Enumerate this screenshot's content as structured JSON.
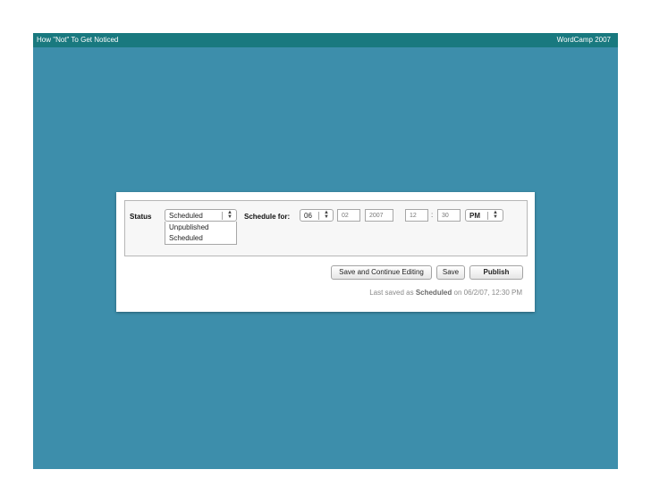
{
  "slide": {
    "title_left": "How \"Not\" To Get Noticed",
    "title_right": "WordCamp 2007",
    "bg_color": "#3d8eab",
    "header_color": "#19797f"
  },
  "form": {
    "status_label": "Status",
    "status_select": {
      "value": "Scheduled",
      "options": [
        "Unpublished",
        "Scheduled"
      ]
    },
    "schedule_label": "Schedule for:",
    "month": "06",
    "day": "02",
    "year": "2007",
    "hour": "12",
    "minute": "30",
    "ampm": "PM",
    "time_separator": ":"
  },
  "actions": {
    "save_continue_label": "Save and Continue Editing",
    "save_label": "Save",
    "publish_label": "Publish"
  },
  "status": {
    "prefix": "Last saved as",
    "state": "Scheduled",
    "suffix": "on 06/2/07, 12:30 PM"
  }
}
